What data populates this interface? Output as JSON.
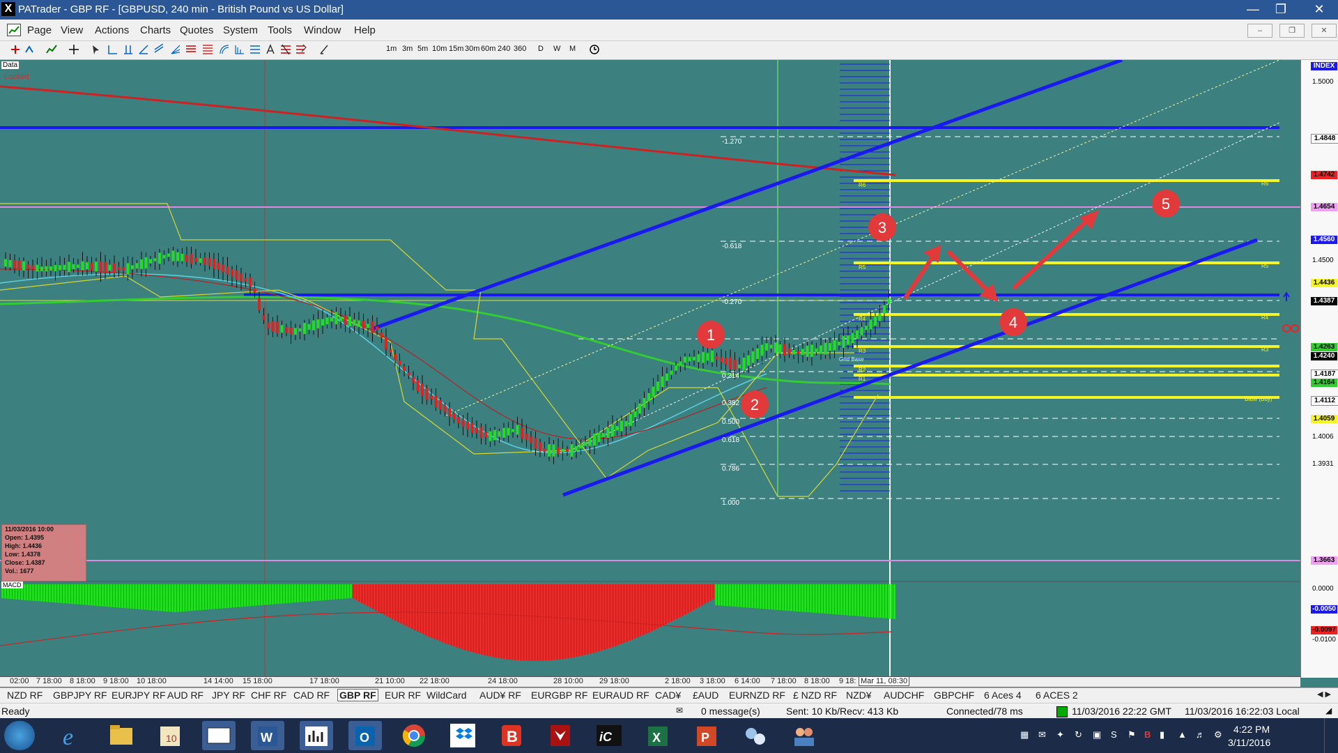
{
  "window": {
    "title": "PATrader - GBP RF - [GBPUSD, 240 min - British Pound vs US Dollar]",
    "icon": "X",
    "min_icon": "minimize-icon",
    "max_icon": "maximize-icon",
    "close_icon": "close-icon"
  },
  "menu": {
    "items": [
      "Page",
      "View",
      "Actions",
      "Charts",
      "Quotes",
      "System",
      "Tools",
      "Window",
      "Help"
    ]
  },
  "toolbar": {
    "timeframes": [
      "1m",
      "3m",
      "5m",
      "10m",
      "15m",
      "30m",
      "60m",
      "240",
      "360",
      "D",
      "W",
      "M"
    ]
  },
  "chart": {
    "data_label": "Data",
    "locked_label": "Locked",
    "fib_labels": [
      "-1.270",
      "-0.618",
      "-0.270",
      "0.214",
      "0.382",
      "0.500",
      "0.618",
      "0.786",
      "1.000"
    ],
    "pivot_tags": [
      "R6",
      "R5",
      "R4",
      "R3",
      "R2",
      "R1",
      "Base (Buy)",
      "Grid Base"
    ],
    "annotations": [
      "1",
      "2",
      "3",
      "4",
      "5"
    ],
    "cursor_time": "Mar 11, 08:30",
    "info": {
      "date": "11/03/2016 10:00",
      "open": "Open: 1.4395",
      "high": "High: 1.4436",
      "low": "Low: 1.4378",
      "close": "Close: 1.4387",
      "vol": "Vol.: 1677"
    },
    "macd_label": "MACD",
    "colors": {
      "background": "#3d8080",
      "up": "#22dd22",
      "down": "#dd2222",
      "trend": "#1a1aee",
      "pivot": "#f5f52a",
      "ma_long": "#cc2222",
      "ma_green": "#33cc33"
    }
  },
  "price_axis": {
    "index_label": "INDEX",
    "labels": [
      "1.5000",
      "1.4848",
      "1.4742",
      "1.4654",
      "1.4560",
      "1.4500",
      "1.4436",
      "1.4387",
      "1.4263",
      "1.4240",
      "1.4187",
      "1.4164",
      "1.4112",
      "1.4059",
      "1.4006",
      "1.3931",
      "1.3663"
    ],
    "macd_labels": [
      "0.0000",
      "-0.0050",
      "-0.0097",
      "-0.0100"
    ]
  },
  "time_axis": {
    "labels": [
      "02:00",
      "7 18:00",
      "8 18:00",
      "9 18:00",
      "10 18:00",
      "14 14:00",
      "15 18:00",
      "17 18:00",
      "21 10:00",
      "22 18:00",
      "24 18:00",
      "28 10:00",
      "29 18:00",
      "2 18:00",
      "3 18:00",
      "6 14:00",
      "7 18:00",
      "8 18:00",
      "9 18:"
    ]
  },
  "tabs": [
    "NZD RF",
    "GBPJPY RF",
    "EURJPY RF",
    "AUD RF",
    "JPY RF",
    "CHF RF",
    "CAD RF",
    "GBP RF",
    "EUR RF",
    "WildCard",
    "AUD¥ RF",
    "EURGBP RF",
    "EURAUD RF",
    "CAD¥",
    "£AUD",
    "EURNZD RF",
    "£ NZD RF",
    "NZD¥",
    "AUDCHF",
    "GBPCHF",
    "6 Aces 4",
    "6 ACES 2"
  ],
  "active_tab": "GBP RF",
  "status": {
    "ready": "Ready",
    "messages": "0 message(s)",
    "traffic": "Sent: 10 Kb/Recv: 413 Kb",
    "connection": "Connected/78 ms",
    "gmt": "11/03/2016 22:22 GMT",
    "local": "11/03/2016 16:22:03 Local"
  },
  "taskbar": {
    "time": "4:22 PM",
    "date": "3/11/2016",
    "apps": [
      "start-button",
      "internet-explorer-icon",
      "file-explorer-icon",
      "calendar-app-icon",
      "blank-window-icon",
      "word-icon",
      "chart-app-icon",
      "outlook-icon",
      "chrome-icon",
      "dropbox-icon",
      "b-app-icon",
      "eagle-app-icon",
      "ic-app-icon",
      "excel-icon",
      "powerpoint-icon",
      "network-app-icon",
      "people-app-icon"
    ]
  }
}
